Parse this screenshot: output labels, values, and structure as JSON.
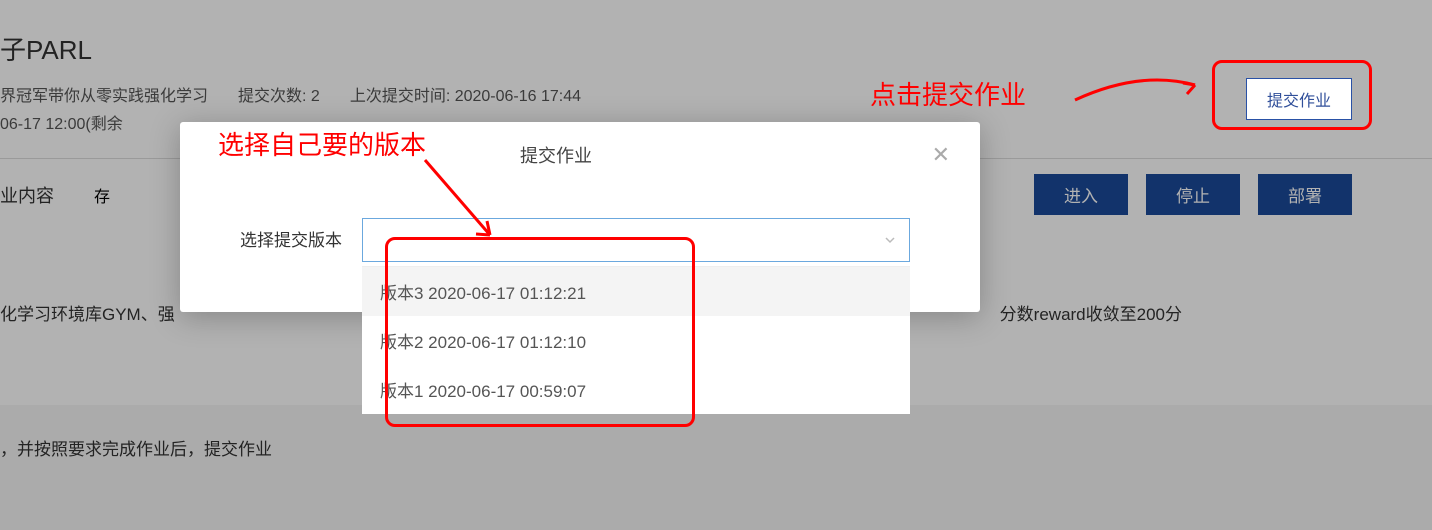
{
  "header": {
    "title": "子PARL",
    "meta_course": "界冠军带你从零实践强化学习",
    "meta_submits": "提交次数: 2",
    "meta_last": "上次提交时间: 2020-06-16 17:44",
    "meta_deadline": "06-17 12:00(剩余",
    "submit_btn": "提交作业"
  },
  "section": {
    "label": "业内容",
    "placeholder_char": "存",
    "buttons": {
      "enter": "进入",
      "stop": "停止",
      "deploy": "部署"
    }
  },
  "body": {
    "desc_left": "化学习环境库GYM、强",
    "desc_right": "分数reward收敛至200分",
    "footer": "，并按照要求完成作业后，提交作业"
  },
  "modal": {
    "title": "提交作业",
    "form_label": "选择提交版本",
    "options": [
      "版本3 2020-06-17 01:12:21",
      "版本2 2020-06-17 01:12:10",
      "版本1 2020-06-17 00:59:07"
    ]
  },
  "annotations": {
    "top_right": "点击提交作业",
    "top_left": "选择自己要的版本"
  },
  "colors": {
    "primary": "#1a4a9a",
    "highlight": "#ff0000"
  }
}
